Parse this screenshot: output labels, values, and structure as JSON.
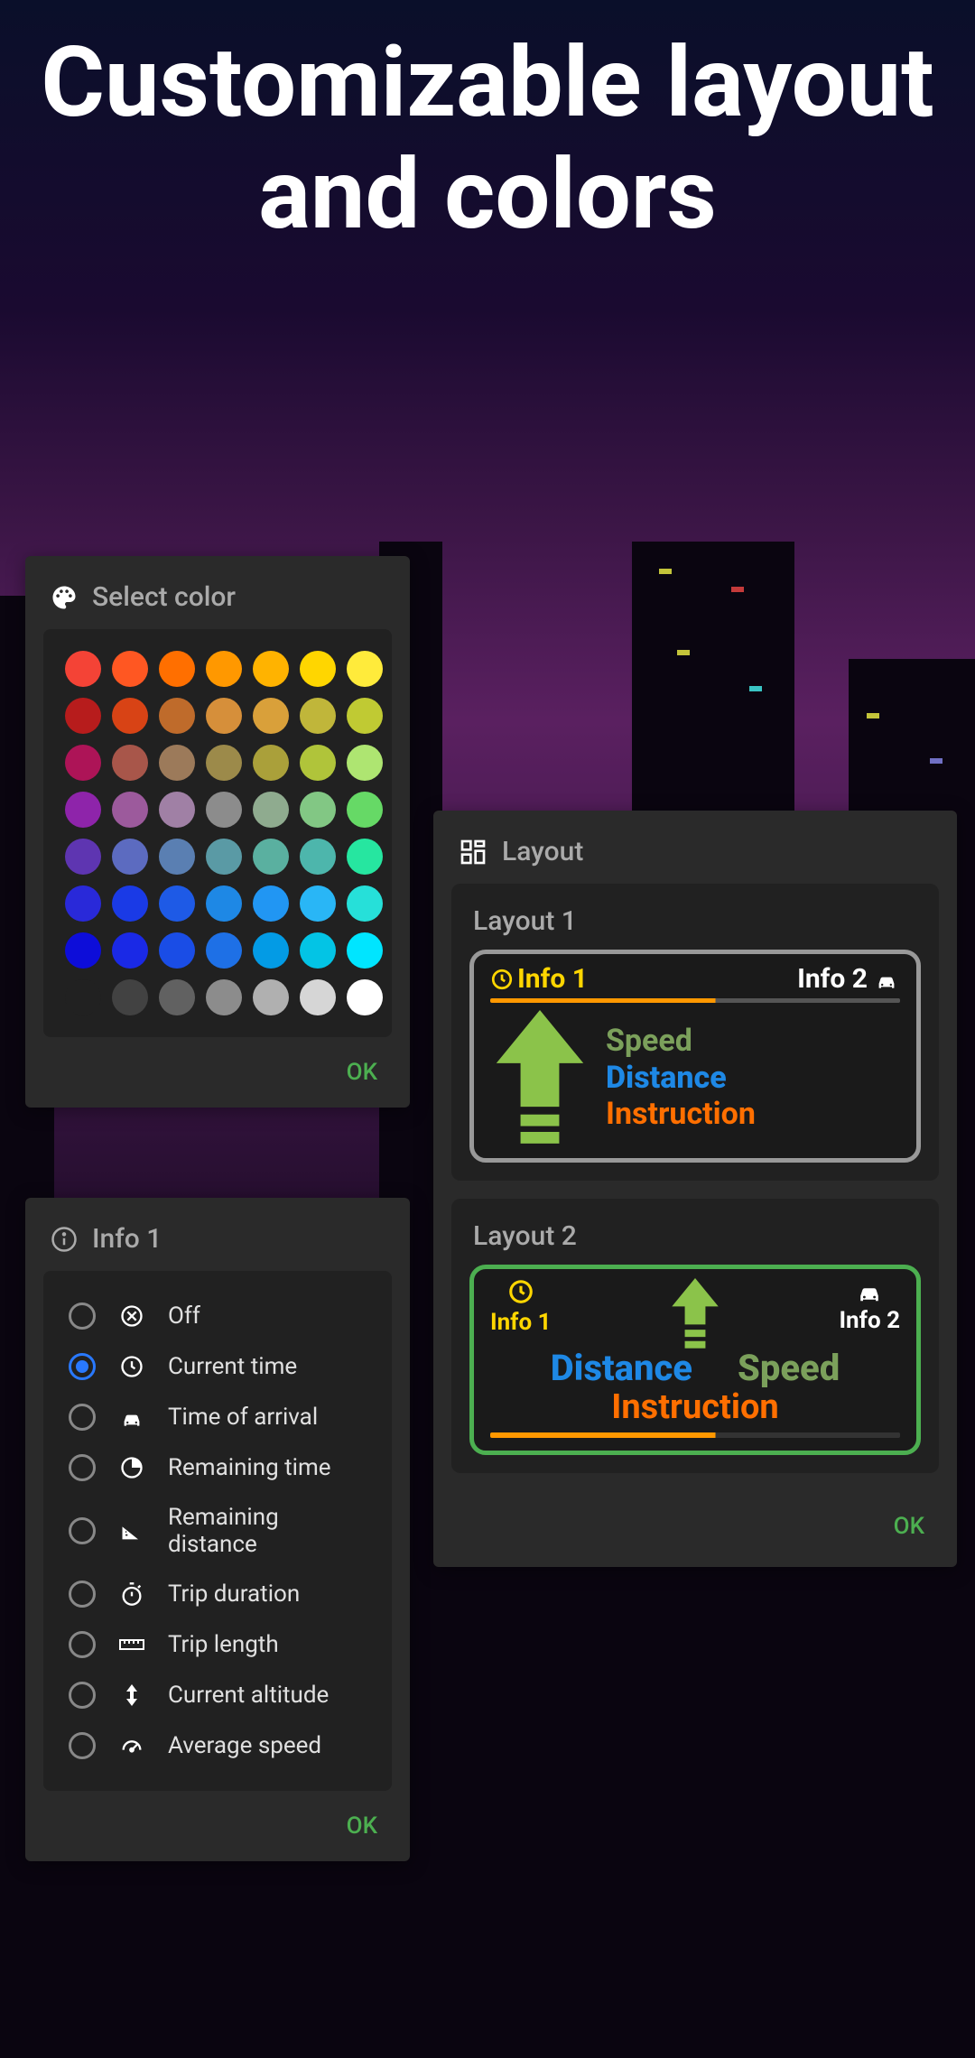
{
  "hero": "Customizable layout and colors",
  "colorPicker": {
    "title": "Select color",
    "ok": "OK",
    "swatches": [
      "#f44336",
      "#ff5722",
      "#ff6f00",
      "#ff9800",
      "#ffb300",
      "#ffd600",
      "#ffeb3b",
      "#b71c1c",
      "#d84315",
      "#bf6b2b",
      "#d68f3a",
      "#d9a03a",
      "#c0b63a",
      "#c0ca33",
      "#ad1457",
      "#a8564a",
      "#9c7a5a",
      "#9c8a4a",
      "#aaa03a",
      "#b0c43a",
      "#aee571",
      "#8e24aa",
      "#9c5a9c",
      "#a080a5",
      "#8c8c8c",
      "#8fab8f",
      "#82c784",
      "#66d966",
      "#5e35b1",
      "#5c6bc0",
      "#5a7fb2",
      "#5a9aa5",
      "#5ab0a0",
      "#4db6ac",
      "#26e6a0",
      "#2929d9",
      "#1a3ae6",
      "#1e5ae6",
      "#1e88e5",
      "#2196f3",
      "#29b6f6",
      "#26e0d9",
      "#0d0dd9",
      "#1a29e6",
      "#1a4de6",
      "#1e70e6",
      "#039be5",
      "#03c4e5",
      "#00e5ff",
      "#212121",
      "#424242",
      "#616161",
      "#8c8c8c",
      "#b0b0b0",
      "#d6d6d6",
      "#ffffff"
    ]
  },
  "infoPanel": {
    "title": "Info 1",
    "ok": "OK",
    "selectedIndex": 1,
    "items": [
      {
        "icon": "off",
        "label": "Off"
      },
      {
        "icon": "clock",
        "label": "Current time"
      },
      {
        "icon": "car",
        "label": "Time of arrival"
      },
      {
        "icon": "remaining-time",
        "label": "Remaining time"
      },
      {
        "icon": "ruler-triangle",
        "label": "Remaining distance"
      },
      {
        "icon": "stopwatch",
        "label": "Trip duration"
      },
      {
        "icon": "ruler",
        "label": "Trip length"
      },
      {
        "icon": "altitude",
        "label": "Current altitude"
      },
      {
        "icon": "gauge",
        "label": "Average speed"
      }
    ]
  },
  "layoutPanel": {
    "title": "Layout",
    "ok": "OK",
    "layouts": [
      {
        "name": "Layout 1",
        "info1": "Info 1",
        "info2": "Info 2",
        "speed": "Speed",
        "distance": "Distance",
        "instruction": "Instruction"
      },
      {
        "name": "Layout 2",
        "info1": "Info 1",
        "info2": "Info 2",
        "speed": "Speed",
        "distance": "Distance",
        "instruction": "Instruction"
      }
    ]
  }
}
